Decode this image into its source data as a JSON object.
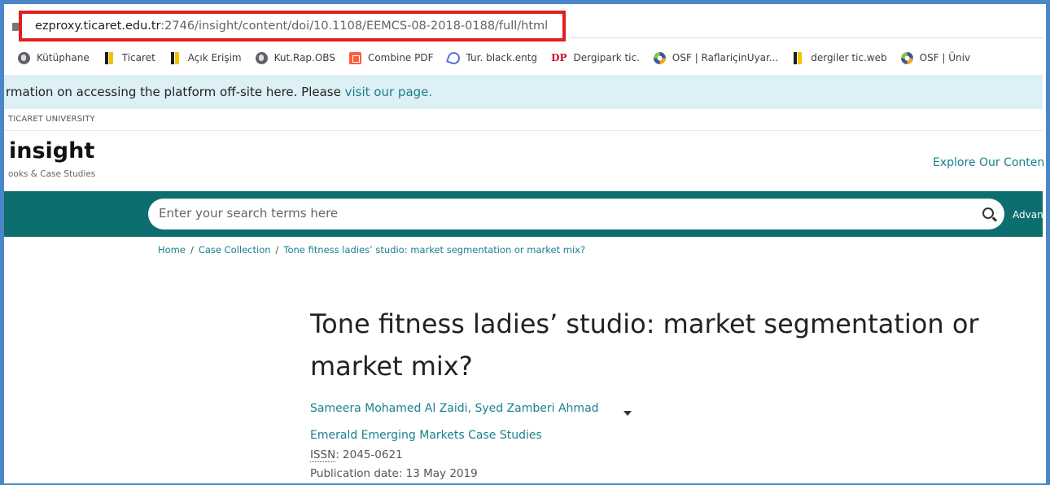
{
  "browser": {
    "url_host": "ezproxy.ticaret.edu.tr",
    "url_path": ":2746/insight/content/doi/10.1108/EEMCS-08-2018-0188/full/html",
    "highlight_color": "#e0201f"
  },
  "bookmarks": [
    {
      "label": "Kütüphane",
      "icon": "globe-icon"
    },
    {
      "label": "Ticaret",
      "icon": "ticaret-logo-icon"
    },
    {
      "label": "Açık Erişim",
      "icon": "ticaret-logo-icon"
    },
    {
      "label": "Kut.Rap.OBS",
      "icon": "globe-icon"
    },
    {
      "label": "Combine PDF",
      "icon": "pdf-icon"
    },
    {
      "label": "Tur. black.entg",
      "icon": "turnitin-icon"
    },
    {
      "label": "Dergipark tic.",
      "icon": "dergipark-icon",
      "icon_text": "DP"
    },
    {
      "label": "OSF | RaflariçinUyar...",
      "icon": "osf-icon"
    },
    {
      "label": "dergiler tic.web",
      "icon": "ticaret-logo-icon"
    },
    {
      "label": "OSF | Üniv",
      "icon": "osf-icon"
    }
  ],
  "banner": {
    "text": "rmation on accessing the platform off-site here. Please ",
    "link": "visit our page."
  },
  "institution": "TICARET UNIVERSITY",
  "site": {
    "logo": "insight",
    "logo_sub": "ooks & Case Studies",
    "explore": "Explore Our Conten"
  },
  "search": {
    "placeholder": "Enter your search terms here",
    "advanced": "Advan"
  },
  "breadcrumb": {
    "home": "Home",
    "collection": "Case Collection",
    "current": "Tone fitness ladies’ studio: market segmentation or market mix?"
  },
  "article": {
    "title_line1": "Tone fitness ladies’ studio: market segmentation or",
    "title_line2": "market mix?",
    "authors": "Sameera Mohamed Al Zaidi, Syed Zamberi Ahmad",
    "journal": "Emerald Emerging Markets Case Studies",
    "issn_label": "ISSN",
    "issn_value": ": 2045-0621",
    "pub_date": "Publication date: 13 May 2019"
  },
  "colors": {
    "frame": "#4a86c8",
    "teal": "#0c6e6e",
    "link": "#1a7f8e",
    "banner_bg": "#dcf0f6"
  }
}
